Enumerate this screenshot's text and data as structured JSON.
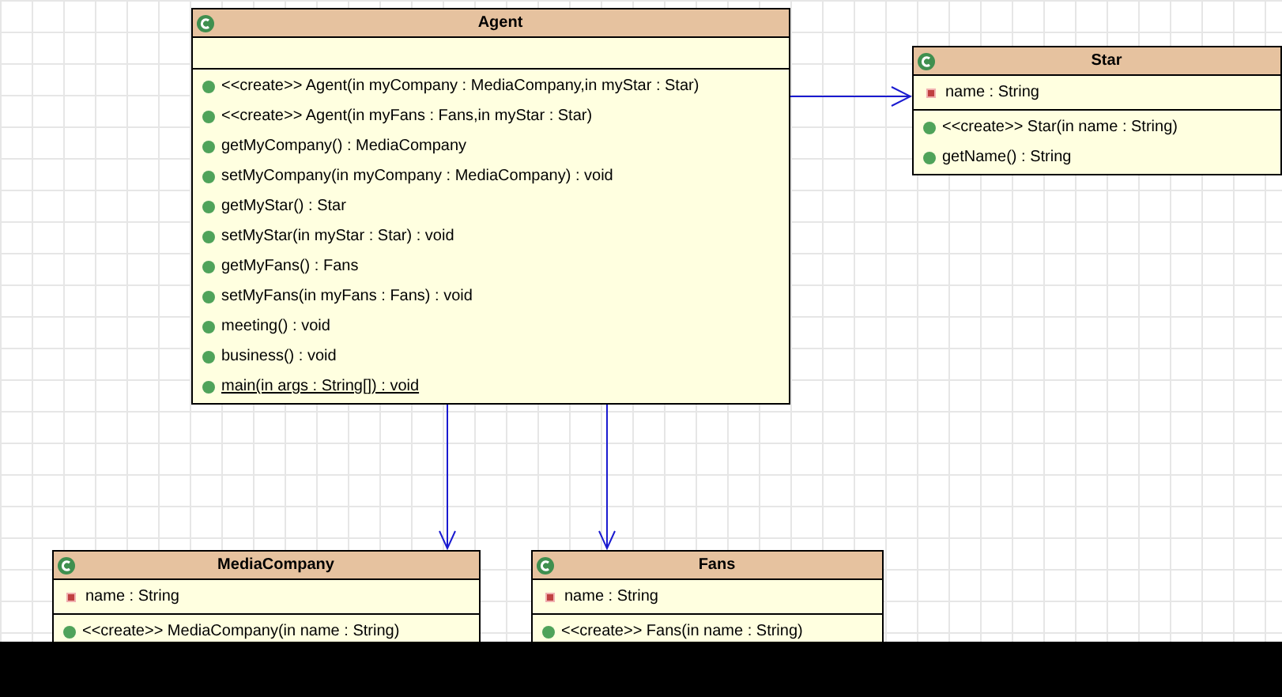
{
  "classes": [
    {
      "name": "Agent",
      "operations": [
        {
          "text": "<<create>> Agent(in myCompany : MediaCompany,in myStar : Star)",
          "static": false
        },
        {
          "text": "<<create>> Agent(in myFans : Fans,in myStar : Star)",
          "static": false
        },
        {
          "text": "getMyCompany() : MediaCompany",
          "static": false
        },
        {
          "text": "setMyCompany(in myCompany : MediaCompany) : void",
          "static": false
        },
        {
          "text": "getMyStar() : Star",
          "static": false
        },
        {
          "text": "setMyStar(in myStar : Star) : void",
          "static": false
        },
        {
          "text": "getMyFans() : Fans",
          "static": false
        },
        {
          "text": "setMyFans(in myFans : Fans) : void",
          "static": false
        },
        {
          "text": "meeting() : void",
          "static": false
        },
        {
          "text": "business() : void",
          "static": false
        },
        {
          "text": "main(in args : String[]) : void",
          "static": true
        }
      ]
    },
    {
      "name": "Star",
      "attributes": [
        {
          "text": "name : String",
          "kind": "private"
        }
      ],
      "operations": [
        {
          "text": "<<create>> Star(in name : String)",
          "static": false
        },
        {
          "text": "getName() : String",
          "static": false
        }
      ]
    },
    {
      "name": "MediaCompany",
      "attributes": [
        {
          "text": "name : String",
          "kind": "private"
        }
      ],
      "operations": [
        {
          "text": "<<create>> MediaCompany(in name : String)",
          "static": false
        }
      ]
    },
    {
      "name": "Fans",
      "attributes": [
        {
          "text": "name : String",
          "kind": "private"
        }
      ],
      "operations": [
        {
          "text": "<<create>> Fans(in name : String)",
          "static": false
        }
      ]
    }
  ]
}
